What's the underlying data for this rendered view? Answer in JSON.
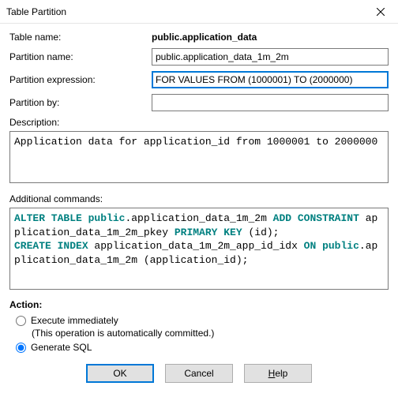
{
  "titlebar": {
    "title": "Table Partition"
  },
  "fields": {
    "table_name_label": "Table name:",
    "table_name_value": "public.application_data",
    "partition_name_label": "Partition name:",
    "partition_name_value": "public.application_data_1m_2m",
    "partition_expr_label": "Partition expression:",
    "partition_expr_value": "FOR VALUES FROM (1000001) TO (2000000)",
    "partition_by_label": "Partition by:",
    "partition_by_value": "",
    "description_label": "Description:",
    "description_value": "Application data for application_id from 1000001 to 2000000",
    "additional_label": "Additional commands:"
  },
  "sql": {
    "t1_kw1": "ALTER TABLE public",
    "t1_p1": ".application_data_1m_2m ",
    "t1_kw2": "ADD CONSTRAINT",
    "t1_p2": " application_data_1m_2m_pkey ",
    "t1_kw3": "PRIMARY KEY",
    "t1_p3": " (id);",
    "t2_kw1": "CREATE INDEX",
    "t2_p1": " application_data_1m_2m_app_id_idx ",
    "t2_kw2": "ON public",
    "t2_p2": ".application_data_1m_2m (application_id);"
  },
  "action": {
    "header": "Action:",
    "execute_label": "Execute immediately",
    "execute_note": "(This operation is automatically committed.)",
    "generate_label": "Generate SQL",
    "selected": "generate"
  },
  "buttons": {
    "ok": "OK",
    "cancel": "Cancel",
    "help_prefix": "H",
    "help_rest": "elp"
  }
}
